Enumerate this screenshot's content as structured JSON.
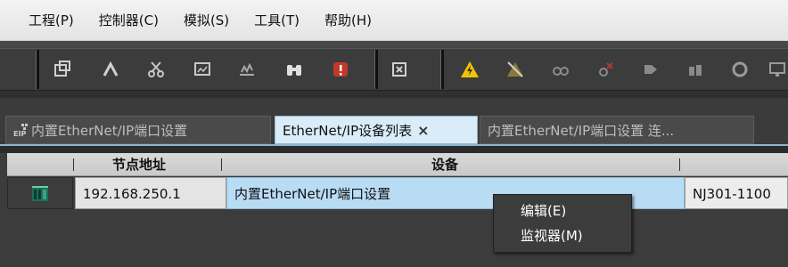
{
  "menu": {
    "items": [
      {
        "label": "工程(P)"
      },
      {
        "label": "控制器(C)"
      },
      {
        "label": "模拟(S)"
      },
      {
        "label": "工具(T)"
      },
      {
        "label": "帮助(H)"
      }
    ]
  },
  "toolbar": {
    "icons": [
      "window-icon",
      "pointer-icon",
      "scissors-icon",
      "display-icon",
      "graph-icon",
      "binoculars-icon",
      "warning-red-icon",
      "program-icon",
      "online-warning-icon",
      "offline-icon",
      "sync-icon",
      "transfer-icon",
      "upload-icon",
      "compare-icon",
      "reset-icon",
      "monitor-icon"
    ]
  },
  "tabs": [
    {
      "label": "内置EtherNet/IP端口设置",
      "icon": "eip-icon",
      "active": false
    },
    {
      "label": "EtherNet/IP设备列表",
      "close": "×",
      "active": true
    },
    {
      "label": "内置EtherNet/IP端口设置 连...",
      "active": false
    }
  ],
  "table": {
    "headers": [
      "节点地址",
      "设备"
    ],
    "rows": [
      {
        "node_address": "192.168.250.1",
        "device": "内置EtherNet/IP端口设置",
        "model": "NJ301-1100",
        "icon": "controller-icon"
      }
    ]
  },
  "context_menu": {
    "items": [
      {
        "label": "编辑(E)"
      },
      {
        "label": "监视器(M)"
      }
    ]
  },
  "colors": {
    "accent": "#b9dcf5",
    "active_tab": "#d9ecf8",
    "dark_bg": "#3c3c3c",
    "warning": "#f5c400"
  }
}
